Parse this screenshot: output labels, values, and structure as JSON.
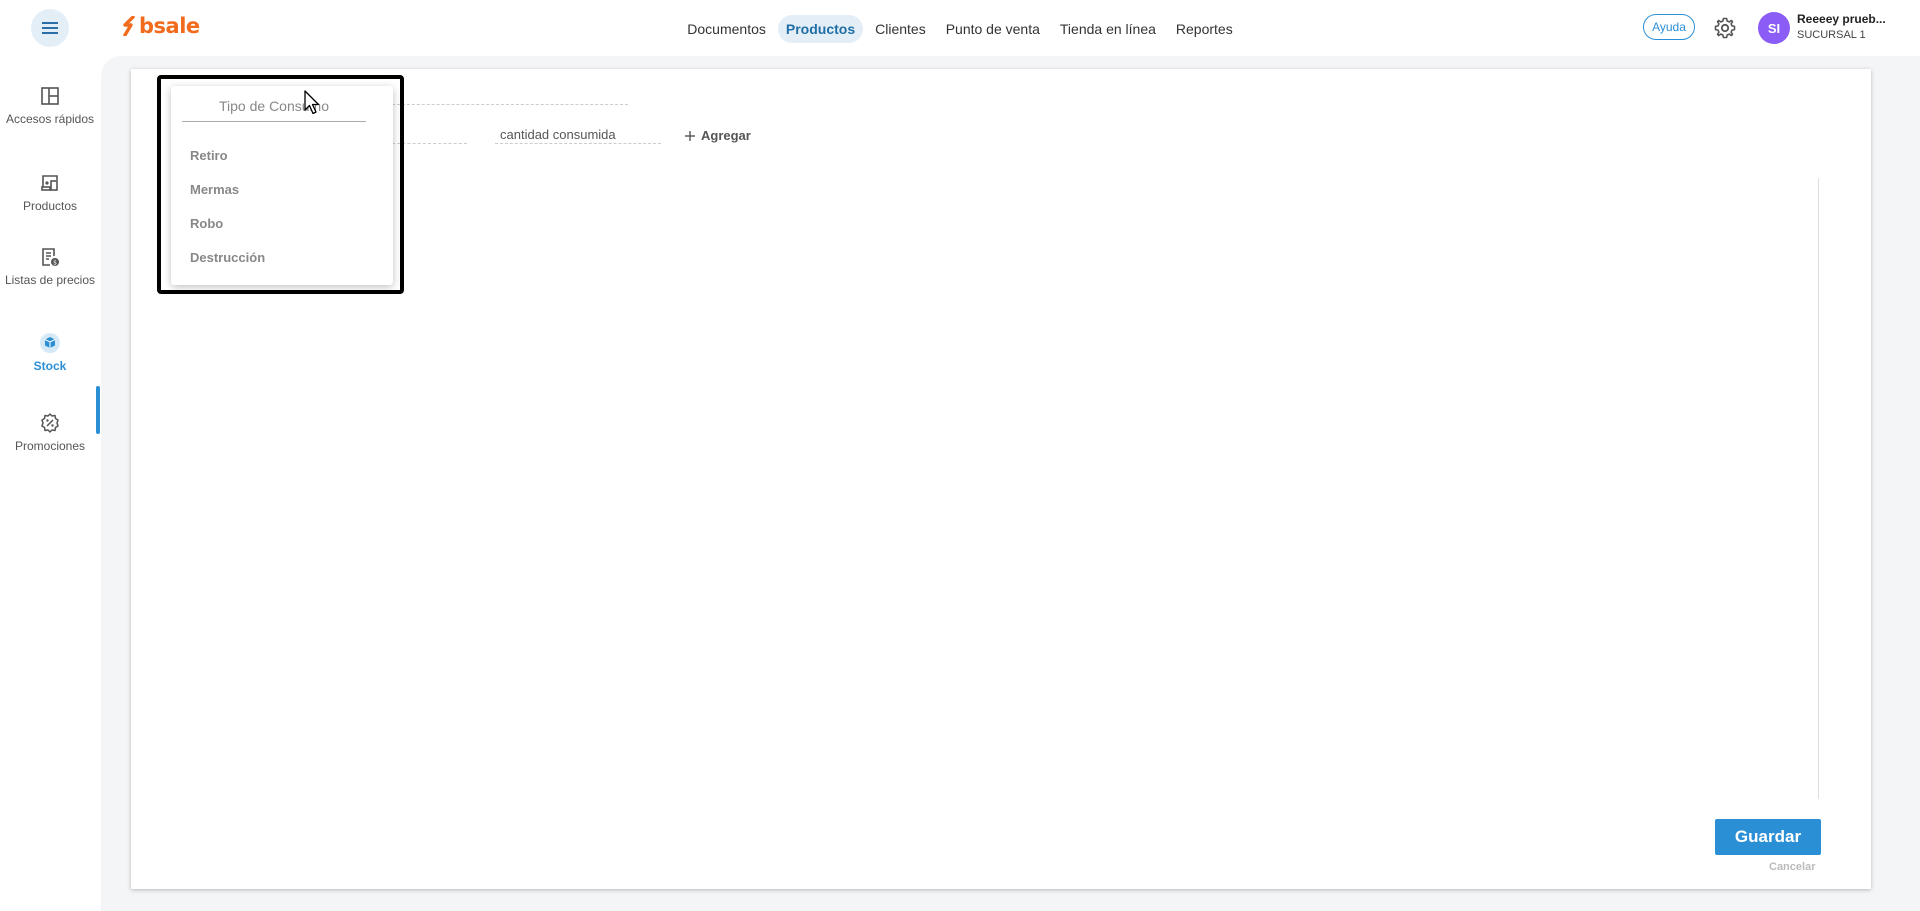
{
  "app": {
    "logo_text": "bsale",
    "brand_color": "#f26a1b",
    "accent_color": "#2b8fd6"
  },
  "topnav": {
    "items": [
      {
        "label": "Documentos"
      },
      {
        "label": "Productos",
        "active": true
      },
      {
        "label": "Clientes"
      },
      {
        "label": "Punto de venta"
      },
      {
        "label": "Tienda en línea"
      },
      {
        "label": "Reportes"
      }
    ],
    "help_label": "Ayuda",
    "user": {
      "initials": "SI",
      "name": "Reeeey prueb...",
      "branch": "SUCURSAL 1",
      "avatar_color": "#8b5cf6"
    }
  },
  "sidebar": {
    "items": [
      {
        "label": "Accesos rápidos",
        "icon": "quick-access-icon"
      },
      {
        "label": "Productos",
        "icon": "products-icon"
      },
      {
        "label": "Listas de precios",
        "icon": "price-list-icon"
      },
      {
        "label": "Stock",
        "icon": "stock-box-icon",
        "active": true
      },
      {
        "label": "Promociones",
        "icon": "promotions-icon"
      }
    ]
  },
  "form": {
    "quantity_placeholder": "cantidad consumida",
    "add_label": "Agregar",
    "save_label": "Guardar",
    "cancel_label": "Cancelar"
  },
  "dropdown": {
    "search_placeholder": "Tipo de Consumo",
    "options": [
      "Retiro",
      "Mermas",
      "Robo",
      "Destrucción"
    ]
  }
}
